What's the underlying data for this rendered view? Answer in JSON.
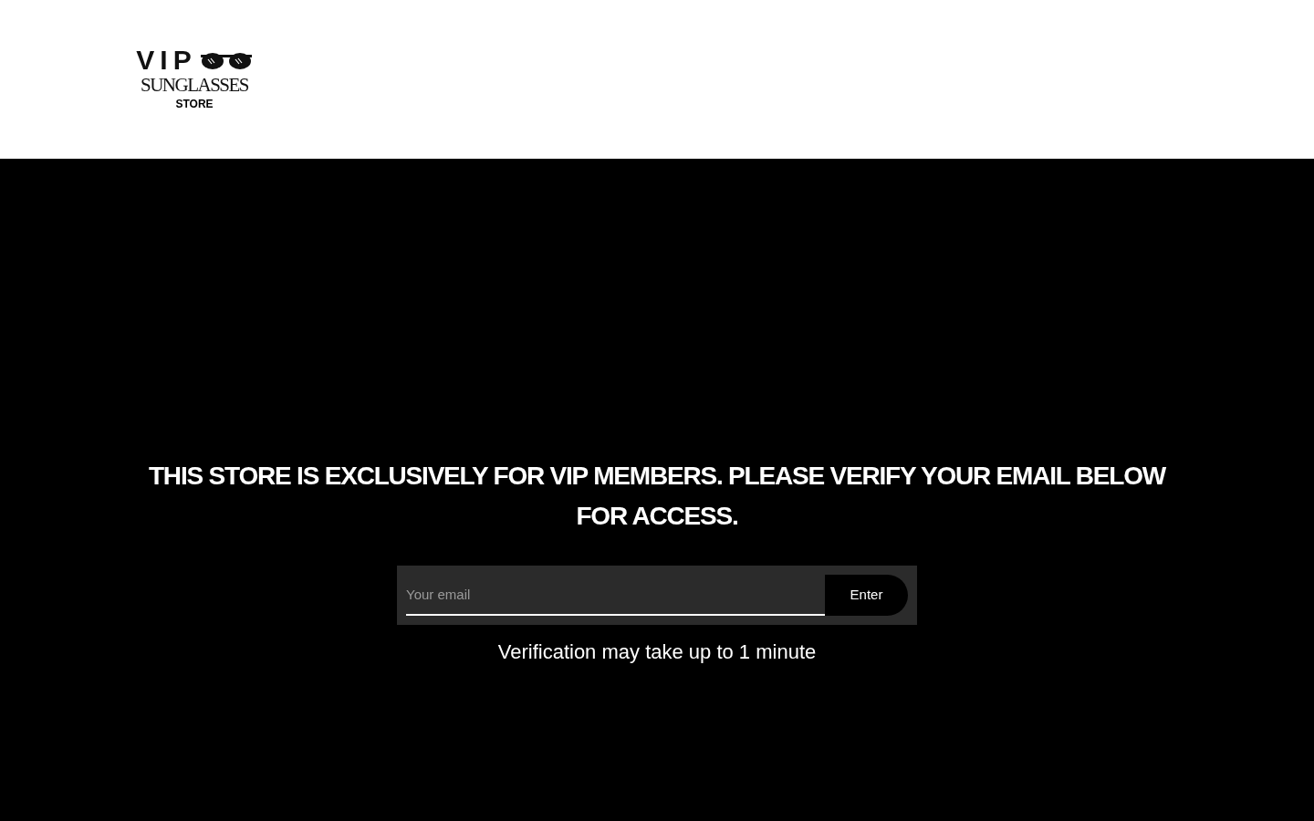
{
  "header": {
    "logo": {
      "line_1": "VIP",
      "line_2": "SUNGLASSES",
      "line_3": "STORE"
    }
  },
  "gate": {
    "heading": "THIS STORE IS EXCLUSIVELY FOR VIP MEMBERS. PLEASE VERIFY YOUR EMAIL BELOW FOR ACCESS.",
    "email_field": {
      "placeholder": "Your email"
    },
    "submit_button": "Enter",
    "note": "Verification may take up to 1 minute"
  }
}
